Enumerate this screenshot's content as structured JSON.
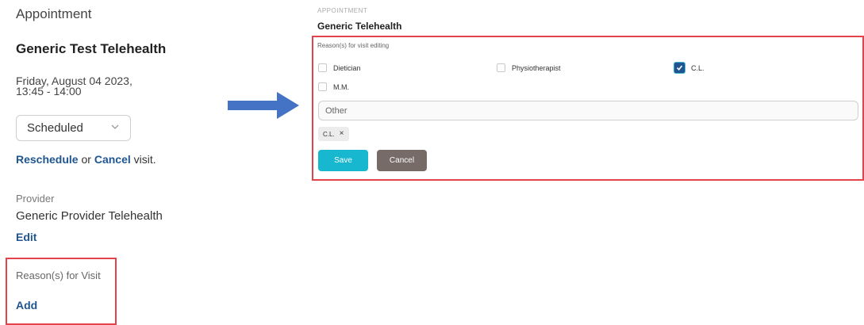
{
  "left_panel": {
    "heading": "Appointment",
    "title": "Generic Test Telehealth",
    "date": "Friday, August 04 2023,",
    "time": "13:45 - 14:00",
    "status": {
      "value": "Scheduled",
      "icon": "chevron-down-icon"
    },
    "actions": {
      "reschedule": "Reschedule",
      "or": " or ",
      "cancel": "Cancel",
      "suffix": " visit."
    },
    "provider": {
      "label": "Provider",
      "name": "Generic Provider Telehealth",
      "edit": "Edit"
    },
    "reason": {
      "label": "Reason(s) for Visit",
      "add": "Add"
    }
  },
  "arrow": {
    "icon": "arrow-right-icon",
    "color": "#4472c4"
  },
  "right_panel": {
    "caption": "APPOINTMENT",
    "title": "Generic Telehealth",
    "editing_label": "Reason(s) for visit editing",
    "options": [
      {
        "label": "Dietician",
        "checked": false
      },
      {
        "label": "Physiotherapist",
        "checked": false
      },
      {
        "label": "C.L.",
        "checked": true
      },
      {
        "label": "M.M.",
        "checked": false
      }
    ],
    "other_placeholder": "Other",
    "selected_chips": [
      {
        "label": "C.L.",
        "remove": "×"
      }
    ],
    "save_label": "Save",
    "cancel_label": "Cancel"
  },
  "colors": {
    "highlight_border": "#e5434b",
    "link": "#1f5591",
    "save_button": "#17b7cf",
    "cancel_button": "#776b67"
  }
}
